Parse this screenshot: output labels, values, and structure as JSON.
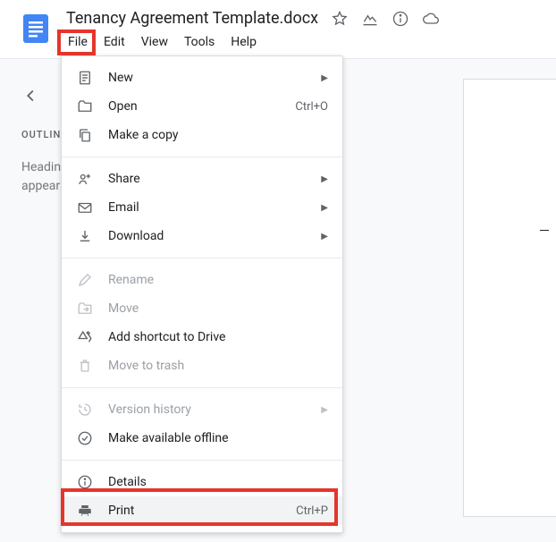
{
  "header": {
    "title": "Tenancy Agreement Template.docx"
  },
  "menubar": {
    "file": "File",
    "edit": "Edit",
    "view": "View",
    "tools": "Tools",
    "help": "Help"
  },
  "sidebar": {
    "outline_label": "OUTLIN",
    "hint_line1": "Headin",
    "hint_line2": "appear"
  },
  "menu": {
    "new": "New",
    "open": "Open",
    "open_shortcut": "Ctrl+O",
    "make_copy": "Make a copy",
    "share": "Share",
    "email": "Email",
    "download": "Download",
    "rename": "Rename",
    "move": "Move",
    "add_shortcut": "Add shortcut to Drive",
    "trash": "Move to trash",
    "version_history": "Version history",
    "offline": "Make available offline",
    "details": "Details",
    "print": "Print",
    "print_shortcut": "Ctrl+P"
  }
}
